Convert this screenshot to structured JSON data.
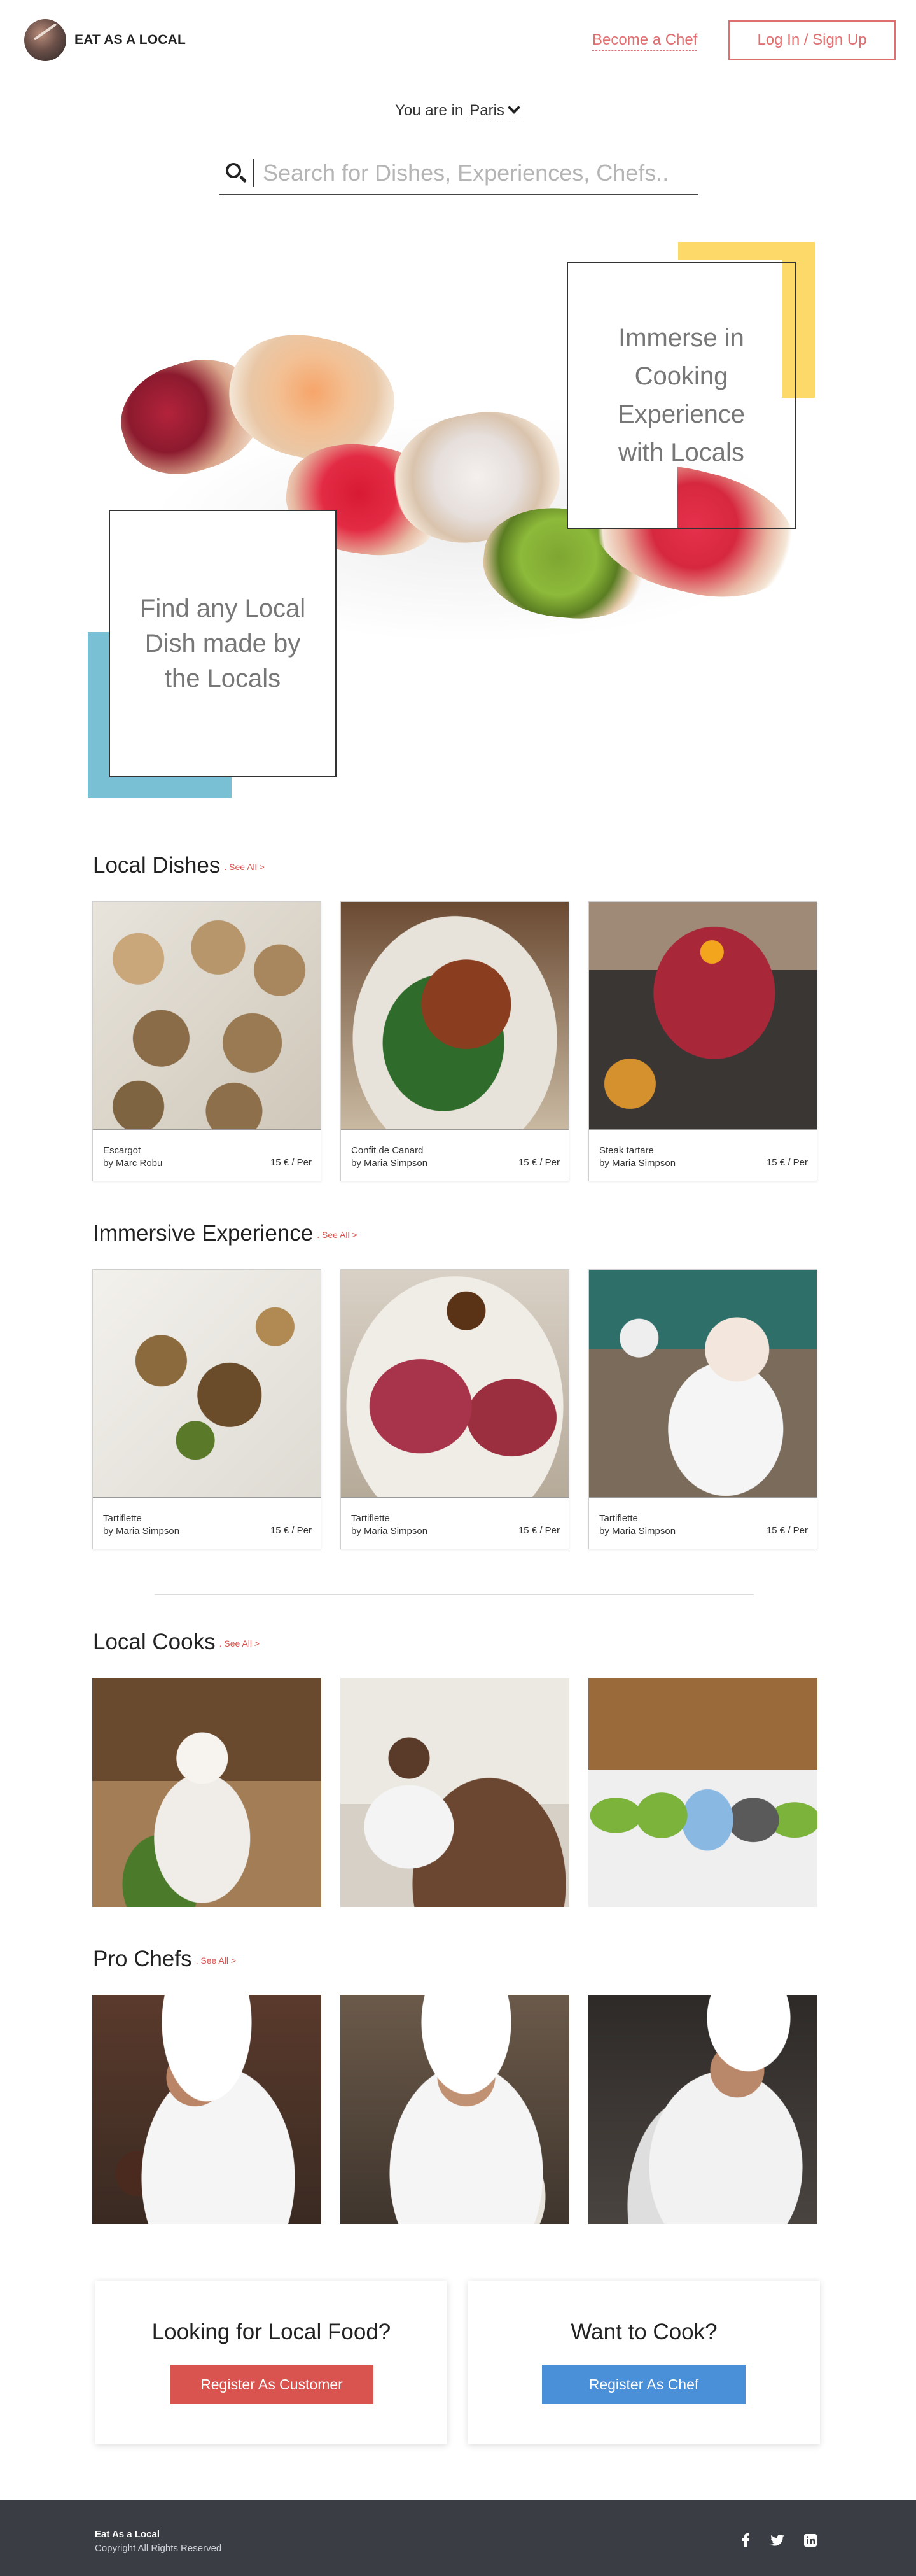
{
  "header": {
    "brand": "EAT AS A LOCAL",
    "become_chef": "Become a Chef",
    "login": "Log In / Sign Up"
  },
  "location": {
    "prefix": "You are in",
    "city": "Paris"
  },
  "search": {
    "placeholder": "Search for Dishes, Experiences, Chefs..."
  },
  "hero": {
    "right_text": "Immerse in Cooking Experience with Locals",
    "left_text": "Find any Local Dish made by the Locals",
    "colors": {
      "yellow": "#fcd968",
      "blue": "#79c0d4"
    }
  },
  "sections": {
    "local_dishes": {
      "title": "Local Dishes",
      "see_all": ". See All >",
      "cards": [
        {
          "name": "Escargot",
          "by": "by Marc Robu",
          "price": "15 € / Per"
        },
        {
          "name": "Confit de Canard",
          "by": "by Maria Simpson",
          "price": "15 € / Per"
        },
        {
          "name": "Steak tartare",
          "by": "by Maria Simpson",
          "price": "15 € / Per"
        }
      ]
    },
    "immersive": {
      "title": "Immersive Experience",
      "see_all": ". See All >",
      "cards": [
        {
          "name": "Tartiflette",
          "by": "by Maria Simpson",
          "price": "15 € / Per"
        },
        {
          "name": "Tartiflette",
          "by": "by Maria Simpson",
          "price": "15 € / Per"
        },
        {
          "name": "Tartiflette",
          "by": "by Maria Simpson",
          "price": "15 € / Per"
        }
      ]
    },
    "local_cooks": {
      "title": "Local Cooks",
      "see_all": ". See All >"
    },
    "pro_chefs": {
      "title": "Pro Chefs",
      "see_all": ". See All >"
    }
  },
  "cta": {
    "customer": {
      "title": "Looking for Local Food?",
      "button": "Register As Customer",
      "color": "#d9534f"
    },
    "chef": {
      "title": "Want to Cook?",
      "button": "Register As Chef",
      "color": "#4a90d9"
    }
  },
  "footer": {
    "brand": "Eat As a Local",
    "copyright": "Copyright All Rights Reserved",
    "social": [
      "facebook-icon",
      "twitter-icon",
      "linkedin-icon"
    ]
  }
}
